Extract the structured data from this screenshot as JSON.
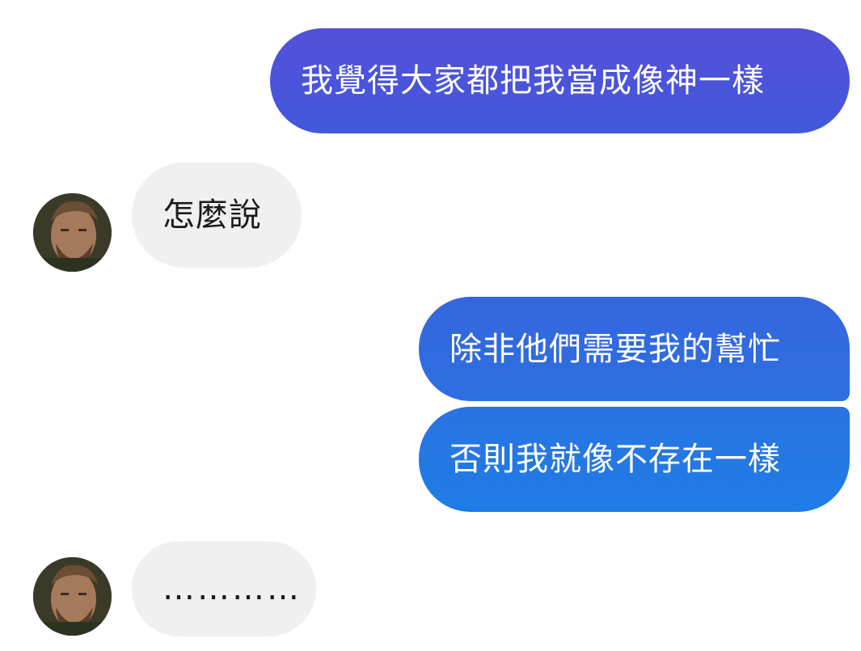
{
  "conversation": {
    "messages": [
      {
        "sender": "me",
        "text": "我覺得大家都把我當成像神一樣",
        "color": "#4a56d9"
      },
      {
        "sender": "contact",
        "text": "怎麼說"
      },
      {
        "sender": "me",
        "text": "除非他們需要我的幫忙",
        "color": "#2f6ce0"
      },
      {
        "sender": "me",
        "text": "否則我就像不存在一樣",
        "color": "#2478e3"
      },
      {
        "sender": "contact",
        "text": "…………"
      }
    ],
    "contact_avatar_icon": "contact-avatar-photo",
    "colors": {
      "outgoing_top": "#5050d8",
      "outgoing_bottom": "#1f7ae6",
      "incoming": "#f0f0f0"
    }
  }
}
